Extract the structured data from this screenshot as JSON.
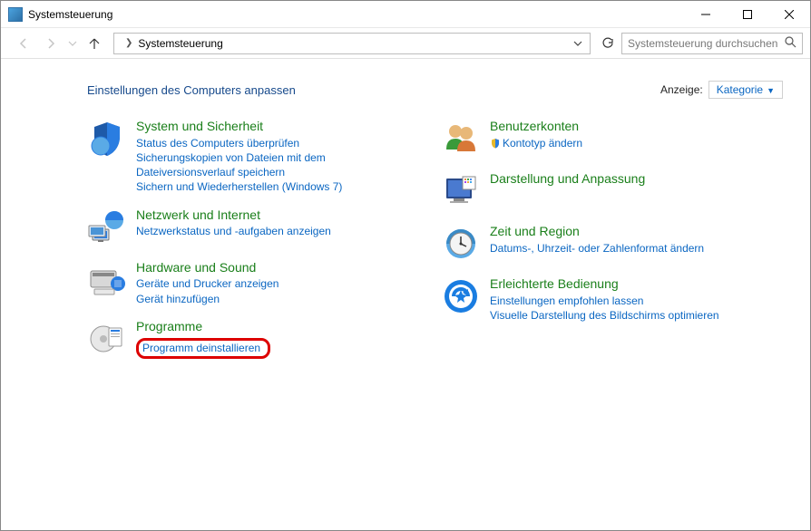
{
  "window": {
    "title": "Systemsteuerung"
  },
  "nav": {
    "breadcrumb": "Systemsteuerung",
    "search_placeholder": "Systemsteuerung durchsuchen"
  },
  "header": {
    "heading": "Einstellungen des Computers anpassen",
    "viewby_label": "Anzeige:",
    "viewby_value": "Kategorie"
  },
  "categories": {
    "col1": [
      {
        "icon": "shield",
        "title": "System und Sicherheit",
        "links": [
          "Status des Computers überprüfen",
          "Sicherungskopien von Dateien mit dem Dateiversionsverlauf speichern",
          "Sichern und Wiederherstellen (Windows 7)"
        ]
      },
      {
        "icon": "network",
        "title": "Netzwerk und Internet",
        "links": [
          "Netzwerkstatus und -aufgaben anzeigen"
        ]
      },
      {
        "icon": "hardware",
        "title": "Hardware und Sound",
        "links": [
          "Geräte und Drucker anzeigen",
          "Gerät hinzufügen"
        ]
      },
      {
        "icon": "programs",
        "title": "Programme",
        "links": [
          "Programm deinstallieren"
        ],
        "highlight_link": 0
      }
    ],
    "col2": [
      {
        "icon": "users",
        "title": "Benutzerkonten",
        "links": [
          "Kontotyp ändern"
        ],
        "link_icons": [
          "shield-small"
        ]
      },
      {
        "icon": "appearance",
        "title": "Darstellung und Anpassung",
        "links": []
      },
      {
        "icon": "clock",
        "title": "Zeit und Region",
        "links": [
          "Datums-, Uhrzeit- oder Zahlenformat ändern"
        ]
      },
      {
        "icon": "ease",
        "title": "Erleichterte Bedienung",
        "links": [
          "Einstellungen empfohlen lassen",
          "Visuelle Darstellung des Bildschirms optimieren"
        ]
      }
    ]
  }
}
